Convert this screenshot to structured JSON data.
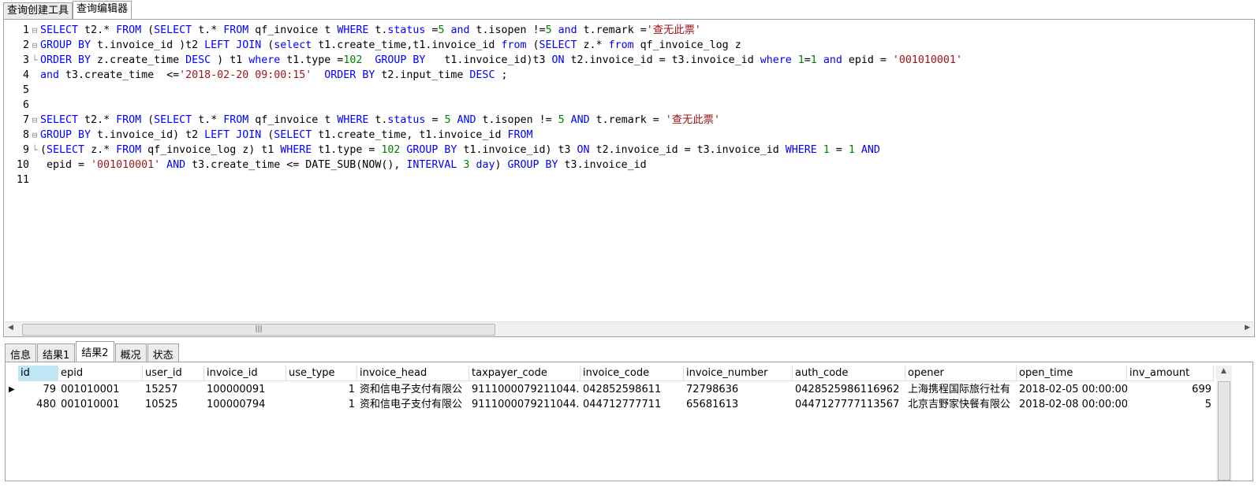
{
  "top_tabs": [
    "查询创建工具",
    "查询编辑器"
  ],
  "active_top_tab": 1,
  "code_lines": [
    [
      [
        "k",
        "SELECT"
      ],
      [
        "p",
        " t2.* "
      ],
      [
        "k",
        "FROM"
      ],
      [
        "p",
        " ("
      ],
      [
        "k",
        "SELECT"
      ],
      [
        "p",
        " t.* "
      ],
      [
        "k",
        "FROM"
      ],
      [
        "p",
        " qf_invoice t "
      ],
      [
        "k",
        "WHERE"
      ],
      [
        "p",
        " t."
      ],
      [
        "k",
        "status"
      ],
      [
        "p",
        " ="
      ],
      [
        "n",
        "5"
      ],
      [
        "p",
        " "
      ],
      [
        "k",
        "and"
      ],
      [
        "p",
        " t.isopen !="
      ],
      [
        "n",
        "5"
      ],
      [
        "p",
        " "
      ],
      [
        "k",
        "and"
      ],
      [
        "p",
        " t.remark ="
      ],
      [
        "s",
        "'查无此票'"
      ]
    ],
    [
      [
        "k",
        "GROUP BY"
      ],
      [
        "p",
        " t.invoice_id )t2 "
      ],
      [
        "k",
        "LEFT JOIN"
      ],
      [
        "p",
        " ("
      ],
      [
        "k",
        "select"
      ],
      [
        "p",
        " t1.create_time,t1.invoice_id "
      ],
      [
        "k",
        "from"
      ],
      [
        "p",
        " ("
      ],
      [
        "k",
        "SELECT"
      ],
      [
        "p",
        " z.* "
      ],
      [
        "k",
        "from"
      ],
      [
        "p",
        " qf_invoice_log z"
      ]
    ],
    [
      [
        "k",
        "ORDER BY"
      ],
      [
        "p",
        " z.create_time "
      ],
      [
        "k",
        "DESC"
      ],
      [
        "p",
        " ) t1 "
      ],
      [
        "k",
        "where"
      ],
      [
        "p",
        " t1.type ="
      ],
      [
        "n",
        "102"
      ],
      [
        "p",
        "  "
      ],
      [
        "k",
        "GROUP BY"
      ],
      [
        "p",
        "   t1.invoice_id)t3 "
      ],
      [
        "k",
        "ON"
      ],
      [
        "p",
        " t2.invoice_id = t3.invoice_id "
      ],
      [
        "k",
        "where"
      ],
      [
        "p",
        " "
      ],
      [
        "n",
        "1"
      ],
      [
        "p",
        "="
      ],
      [
        "n",
        "1"
      ],
      [
        "p",
        " "
      ],
      [
        "k",
        "and"
      ],
      [
        "p",
        " epid = "
      ],
      [
        "s",
        "'001010001'"
      ]
    ],
    [
      [
        "k",
        "and"
      ],
      [
        "p",
        " t3.create_time  <="
      ],
      [
        "s",
        "'2018-02-20 09:00:15'"
      ],
      [
        "p",
        "  "
      ],
      [
        "k",
        "ORDER BY"
      ],
      [
        "p",
        " t2.input_time "
      ],
      [
        "k",
        "DESC"
      ],
      [
        "p",
        " ;"
      ]
    ],
    [],
    [],
    [
      [
        "k",
        "SELECT"
      ],
      [
        "p",
        " t2.* "
      ],
      [
        "k",
        "FROM"
      ],
      [
        "p",
        " ("
      ],
      [
        "k",
        "SELECT"
      ],
      [
        "p",
        " t.* "
      ],
      [
        "k",
        "FROM"
      ],
      [
        "p",
        " qf_invoice t "
      ],
      [
        "k",
        "WHERE"
      ],
      [
        "p",
        " t."
      ],
      [
        "k",
        "status"
      ],
      [
        "p",
        " = "
      ],
      [
        "n",
        "5"
      ],
      [
        "p",
        " "
      ],
      [
        "k",
        "AND"
      ],
      [
        "p",
        " t.isopen != "
      ],
      [
        "n",
        "5"
      ],
      [
        "p",
        " "
      ],
      [
        "k",
        "AND"
      ],
      [
        "p",
        " t.remark = "
      ],
      [
        "s",
        "'查无此票'"
      ]
    ],
    [
      [
        "k",
        "GROUP BY"
      ],
      [
        "p",
        " t.invoice_id) t2 "
      ],
      [
        "k",
        "LEFT JOIN"
      ],
      [
        "p",
        " ("
      ],
      [
        "k",
        "SELECT"
      ],
      [
        "p",
        " t1.create_time, t1.invoice_id "
      ],
      [
        "k",
        "FROM"
      ]
    ],
    [
      [
        "p",
        "("
      ],
      [
        "k",
        "SELECT"
      ],
      [
        "p",
        " z.* "
      ],
      [
        "k",
        "FROM"
      ],
      [
        "p",
        " qf_invoice_log z) t1 "
      ],
      [
        "k",
        "WHERE"
      ],
      [
        "p",
        " t1.type = "
      ],
      [
        "n",
        "102"
      ],
      [
        "p",
        " "
      ],
      [
        "k",
        "GROUP BY"
      ],
      [
        "p",
        " t1.invoice_id) t3 "
      ],
      [
        "k",
        "ON"
      ],
      [
        "p",
        " t2.invoice_id = t3.invoice_id "
      ],
      [
        "k",
        "WHERE"
      ],
      [
        "p",
        " "
      ],
      [
        "n",
        "1"
      ],
      [
        "p",
        " = "
      ],
      [
        "n",
        "1"
      ],
      [
        "p",
        " "
      ],
      [
        "k",
        "AND"
      ]
    ],
    [
      [
        "p",
        " epid = "
      ],
      [
        "s",
        "'001010001'"
      ],
      [
        "p",
        " "
      ],
      [
        "k",
        "AND"
      ],
      [
        "p",
        " t3.create_time <= DATE_SUB(NOW(), "
      ],
      [
        "k",
        "INTERVAL"
      ],
      [
        "p",
        " "
      ],
      [
        "n",
        "3"
      ],
      [
        "p",
        " "
      ],
      [
        "k",
        "day"
      ],
      [
        "p",
        ") "
      ],
      [
        "k",
        "GROUP BY"
      ],
      [
        "p",
        " t3.invoice_id"
      ]
    ],
    []
  ],
  "fold_markers": [
    "⊟",
    "⊟",
    "└",
    "",
    "",
    "",
    "⊟",
    "⊟",
    "└",
    "",
    ""
  ],
  "result_tabs": [
    "信息",
    "结果1",
    "结果2",
    "概况",
    "状态"
  ],
  "active_result_tab": 2,
  "grid": {
    "columns": [
      "id",
      "epid",
      "user_id",
      "invoice_id",
      "use_type",
      "invoice_head",
      "taxpayer_code",
      "invoice_code",
      "invoice_number",
      "auth_code",
      "opener",
      "open_time",
      "inv_amount"
    ],
    "rows": [
      [
        "79",
        "001010001",
        "15257",
        "100000091",
        "1",
        "资和信电子支付有限公",
        "9111000079211044.",
        "042852598611",
        "72798636",
        "0428525986116962",
        "上海携程国际旅行社有",
        "2018-02-05 00:00:00",
        "699"
      ],
      [
        "480",
        "001010001",
        "10525",
        "100000794",
        "1",
        "资和信电子支付有限公",
        "9111000079211044.",
        "044712777711",
        "65681613",
        "0447127777113567",
        "北京吉野家快餐有限公",
        "2018-02-08 00:00:00",
        "5"
      ]
    ]
  },
  "colors": {
    "keyword": "#0000ff",
    "number": "#008000",
    "string": "#a31515",
    "selected_header": "#bfe6f5"
  }
}
